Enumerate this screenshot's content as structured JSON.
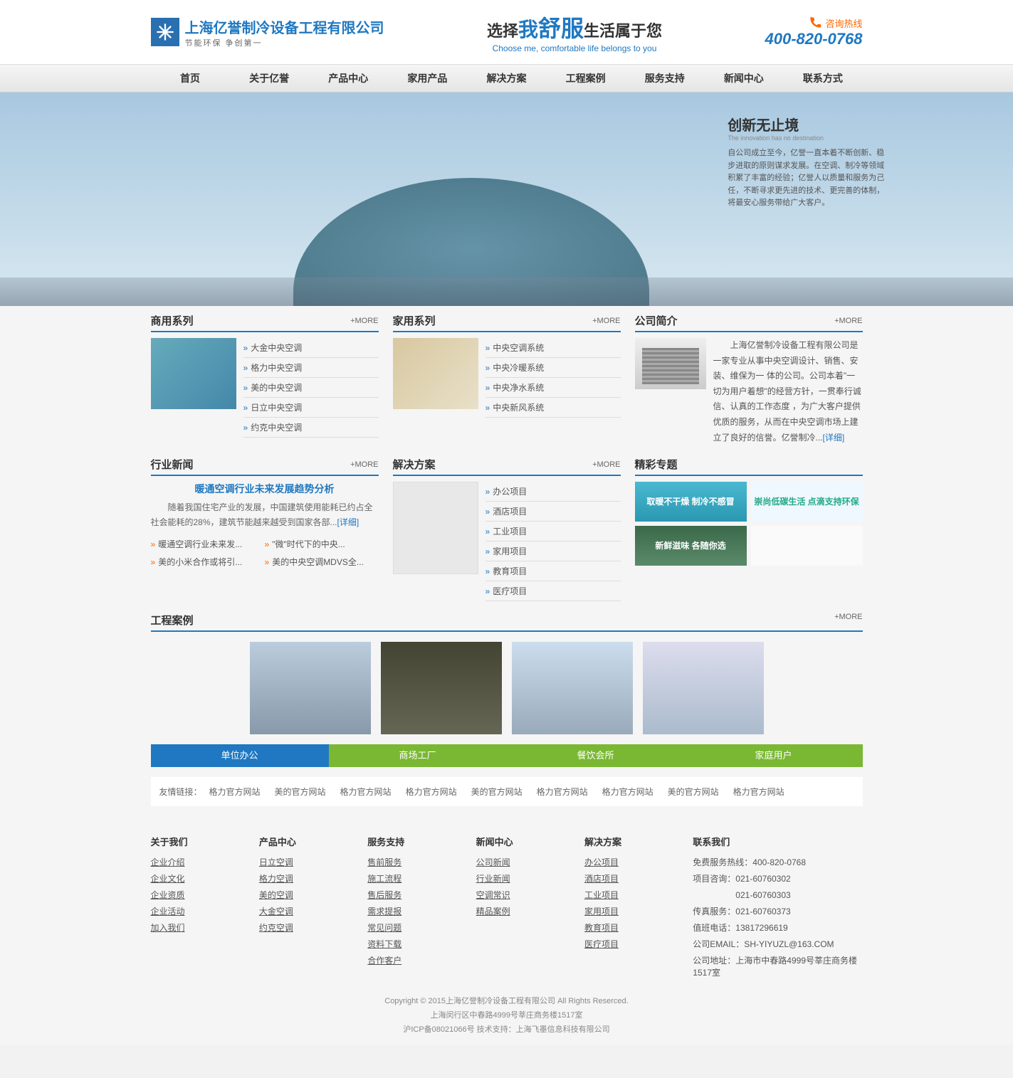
{
  "header": {
    "company_name": "上海亿誉制冷设备工程有限公司",
    "company_tagline": "节能环保  争创第一",
    "slogan_cn_pre": "选择",
    "slogan_cn_mid1": "我",
    "slogan_cn_mid2": "舒服",
    "slogan_cn_post": "生活属于您",
    "slogan_en": "Choose me, comfortable life belongs to you",
    "hotline_label": "咨询热线",
    "hotline_number": "400-820-0768"
  },
  "nav": [
    "首页",
    "关于亿誉",
    "产品中心",
    "家用产品",
    "解决方案",
    "工程案例",
    "服务支持",
    "新闻中心",
    "联系方式"
  ],
  "banner": {
    "title": "创新无止境",
    "title_en": "The innovation has no destination",
    "desc": "自公司成立至今，亿誉一直本着不断创新、稳步进取的原则谋求发展。在空调、制冷等领域积累了丰富的经验；亿誉人以质量和服务为己任，不断寻求更先进的技术、更完善的体制，将最安心服务带给广大客户。"
  },
  "commercial": {
    "title": "商用系列",
    "more": "+MORE",
    "items": [
      "大金中央空调",
      "格力中央空调",
      "美的中央空调",
      "日立中央空调",
      "约克中央空调"
    ]
  },
  "household": {
    "title": "家用系列",
    "more": "+MORE",
    "items": [
      "中央空调系统",
      "中央冷暖系统",
      "中央净水系统",
      "中央新风系统"
    ]
  },
  "company": {
    "title": "公司简介",
    "more": "+MORE",
    "desc": "　　上海亿誉制冷设备工程有限公司是一家专业从事中央空调设计、销售、安装、维保为一 体的公司。公司本着\"一切为用户着想\"的经营方针，一贯奉行诚信、认真的工作态度 ，为广大客户提供优质的服务，从而在中央空调市场上建立了良好的信誉。亿誉制冷...",
    "detail": "[详细]"
  },
  "news": {
    "title": "行业新闻",
    "more": "+MORE",
    "feature_title": "暖通空调行业未来发展趋势分析",
    "feature_desc": "随着我国住宅产业的发展，中国建筑使用能耗已约占全社会能耗的28%，建筑节能越来越受到国家各部...",
    "detail": "[详细]",
    "links": [
      "暖通空调行业未来发...",
      "\"微\"时代下的中央...",
      "美的小米合作或将引...",
      "美的中央空调MDVS全..."
    ]
  },
  "solution": {
    "title": "解决方案",
    "more": "+MORE",
    "items": [
      "办公项目",
      "酒店项目",
      "工业项目",
      "家用项目",
      "教育项目",
      "医疗项目"
    ]
  },
  "topics": {
    "title": "精彩专题",
    "items": [
      "取暖不干燥\n制冷不感冒",
      "崇尚低碳生活\n点滴支持环保",
      "新鲜滋味\n各随你选",
      ""
    ]
  },
  "cases": {
    "title": "工程案例",
    "more": "+MORE",
    "tabs": [
      "单位办公",
      "商场工厂",
      "餐饮会所",
      "家庭用户"
    ]
  },
  "friendlinks": {
    "label": "友情链接：",
    "items": [
      "格力官方网站",
      "美的官方网站",
      "格力官方网站",
      "格力官方网站",
      "美的官方网站",
      "格力官方网站",
      "格力官方网站",
      "美的官方网站",
      "格力官方网站"
    ]
  },
  "footer": {
    "cols": [
      {
        "title": "关于我们",
        "links": [
          "企业介绍",
          "企业文化",
          "企业资质",
          "企业活动",
          "加入我们"
        ]
      },
      {
        "title": "产品中心",
        "links": [
          "日立空调",
          "格力空调",
          "美的空调",
          "大金空调",
          "约克空调"
        ]
      },
      {
        "title": "服务支持",
        "links": [
          "售前服务",
          "施工流程",
          "售后服务",
          "需求提报",
          "常见问题",
          "资料下载",
          "合作客户"
        ]
      },
      {
        "title": "新闻中心",
        "links": [
          "公司新闻",
          "行业新闻",
          "空调常识",
          "精品案例"
        ]
      },
      {
        "title": "解决方案",
        "links": [
          "办公项目",
          "酒店项目",
          "工业项目",
          "家用项目",
          "教育项目",
          "医疗项目"
        ]
      }
    ],
    "contact": {
      "title": "联系我们",
      "lines": [
        "免费服务热线：400-820-0768",
        "项目咨询：021-60760302",
        "　　　　　021-60760303",
        "传真服务：021-60760373",
        "值班电话：13817296619",
        "公司EMAIL：SH-YIYUZL@163.COM",
        "公司地址：上海市中春路4999号莘庄商务楼1517室"
      ]
    },
    "copyright": [
      "Copyright © 2015上海亿誉制冷设备工程有限公司 All Rights Reserced.",
      "上海闵行区中春路4999号莘庄商务楼1517室",
      "沪ICP备08021066号 技术支持：上海飞墨信息科技有限公司"
    ]
  }
}
